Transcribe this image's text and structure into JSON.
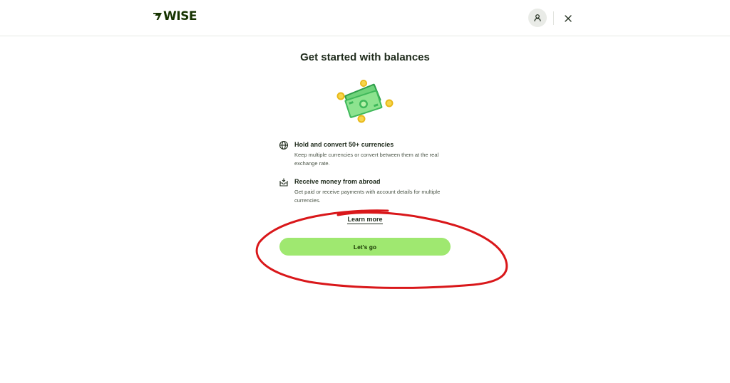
{
  "header": {
    "logo_text": "WISE",
    "logo_icon": "wise-flag-icon",
    "profile_icon": "user-icon",
    "close_icon": "close-icon",
    "brand_color": "#163300"
  },
  "main": {
    "title": "Get started with balances",
    "illustration": "money-notes-and-coins-illustration",
    "features": [
      {
        "icon": "globe-icon",
        "title": "Hold and convert 50+ currencies",
        "description": "Keep multiple currencies or convert between them at the real exchange rate."
      },
      {
        "icon": "inbox-receive-icon",
        "title": "Receive money from abroad",
        "description": "Get paid or receive payments with account details for multiple currencies."
      }
    ],
    "learn_more_label": "Learn more",
    "cta_label": "Let's go",
    "cta_color": "#9fe870"
  },
  "annotation": {
    "type": "hand-drawn-ellipse",
    "color": "#d9171a"
  }
}
